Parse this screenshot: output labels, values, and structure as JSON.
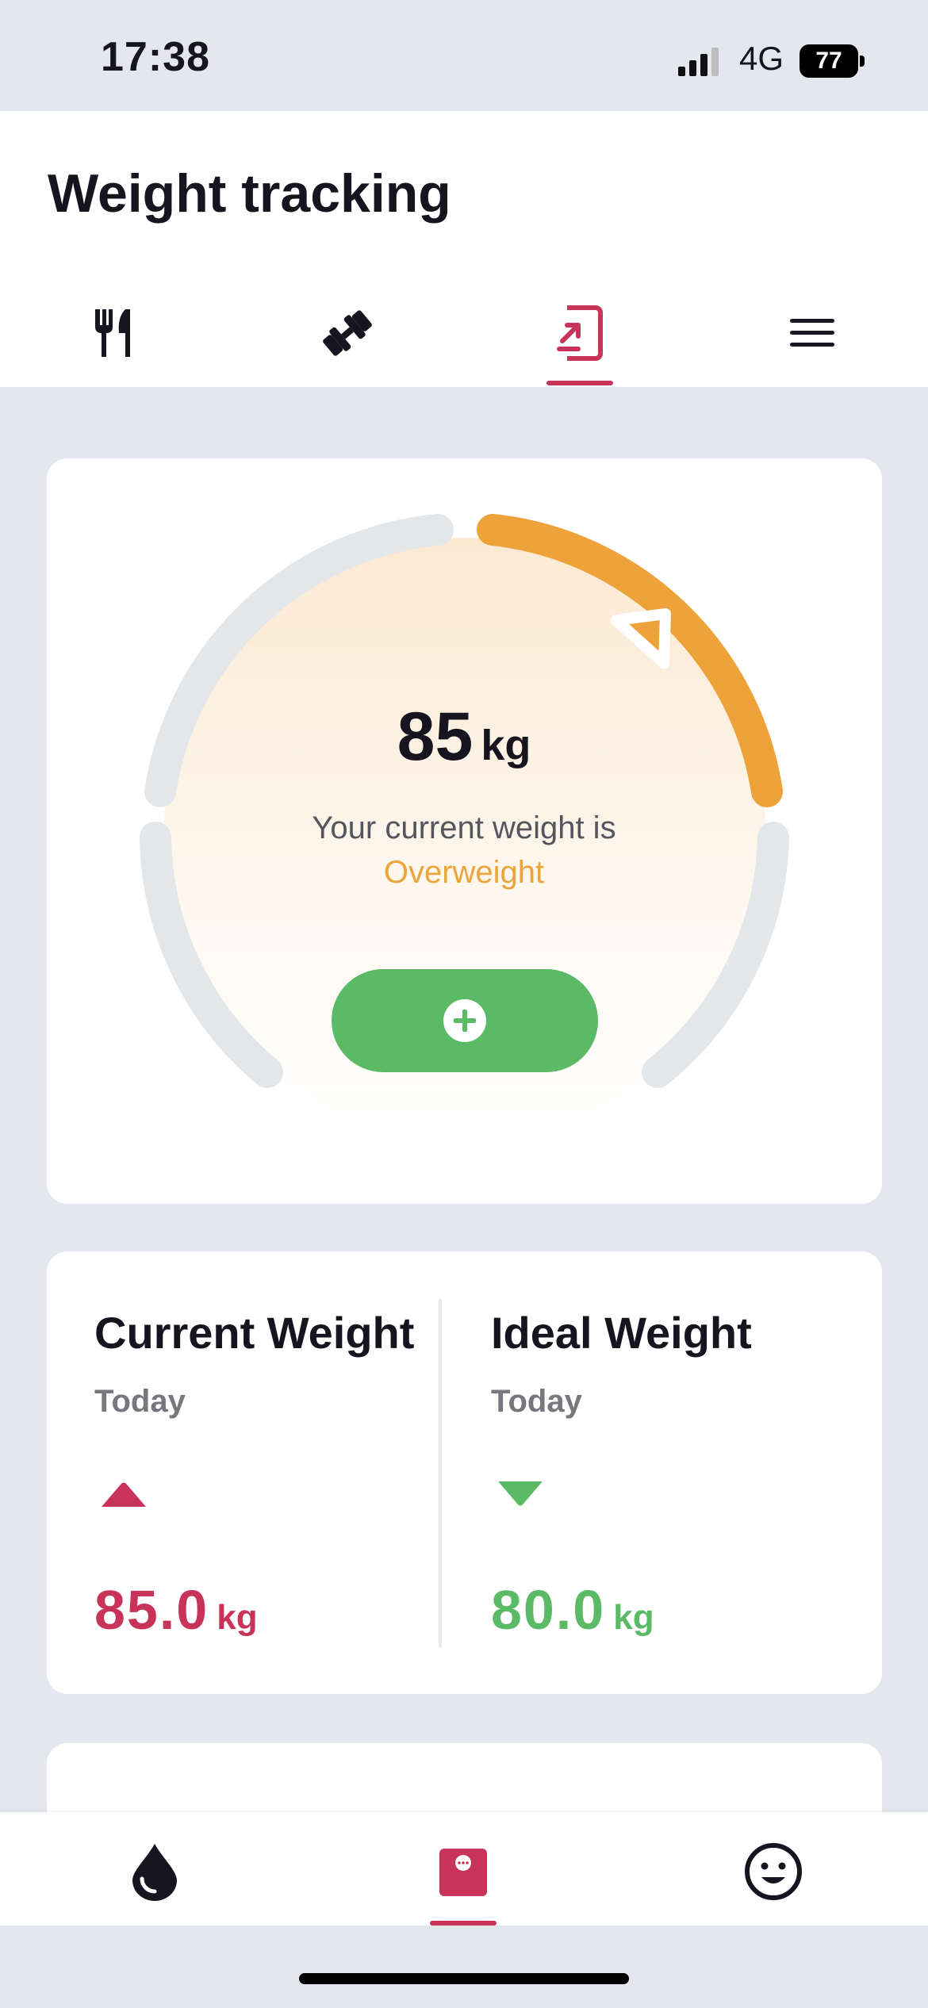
{
  "status_bar": {
    "time": "17:38",
    "network": "4G",
    "battery": "77"
  },
  "header": {
    "title": "Weight tracking"
  },
  "tabs": [
    {
      "icon": "fork-knife-icon",
      "active": false
    },
    {
      "icon": "dumbbell-icon",
      "active": false
    },
    {
      "icon": "scale-entry-icon",
      "active": true
    },
    {
      "icon": "menu-icon",
      "active": false
    }
  ],
  "gauge": {
    "value": "85",
    "unit": "kg",
    "caption": "Your current weight is",
    "status": "Overweight",
    "status_color": "#eca53b",
    "add_icon": "plus-circle-icon"
  },
  "stats": {
    "current": {
      "title": "Current Weight",
      "period": "Today",
      "value": "85.0",
      "unit": "kg",
      "trend": "up",
      "color": "#c8335a"
    },
    "ideal": {
      "title": "Ideal Weight",
      "period": "Today",
      "value": "80.0",
      "unit": "kg",
      "trend": "down",
      "color": "#5bba65"
    }
  },
  "bottom_nav": [
    {
      "icon": "water-drop-icon",
      "active": false
    },
    {
      "icon": "chat-calendar-icon",
      "active": true
    },
    {
      "icon": "smiley-icon",
      "active": false
    }
  ],
  "colors": {
    "accent": "#c8335a",
    "green": "#5bba65",
    "orange": "#eca53b"
  }
}
